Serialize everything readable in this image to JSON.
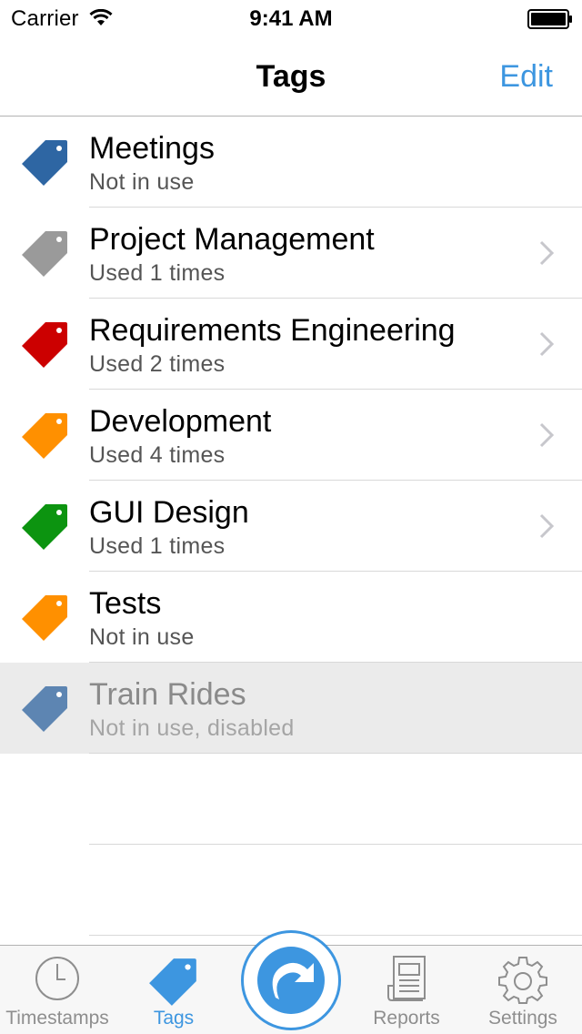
{
  "status_bar": {
    "carrier": "Carrier",
    "time": "9:41 AM"
  },
  "nav": {
    "title": "Tags",
    "edit": "Edit"
  },
  "tags": [
    {
      "name": "Meetings",
      "usage": "Not in use",
      "color": "#2e66a3",
      "chevron": false,
      "disabled": false
    },
    {
      "name": "Project Management",
      "usage": "Used 1 times",
      "color": "#9a9a9a",
      "chevron": true,
      "disabled": false
    },
    {
      "name": "Requirements Engineering",
      "usage": "Used 2 times",
      "color": "#cc0000",
      "chevron": true,
      "disabled": false
    },
    {
      "name": "Development",
      "usage": "Used 4 times",
      "color": "#ff9000",
      "chevron": true,
      "disabled": false
    },
    {
      "name": "GUI Design",
      "usage": "Used 1 times",
      "color": "#0c9410",
      "chevron": true,
      "disabled": false
    },
    {
      "name": "Tests",
      "usage": "Not in use",
      "color": "#ff9000",
      "chevron": false,
      "disabled": false
    },
    {
      "name": "Train Rides",
      "usage": "Not in use, disabled",
      "color": "#5d85b2",
      "chevron": false,
      "disabled": true
    }
  ],
  "tab_bar": {
    "timestamps": "Timestamps",
    "tags": "Tags",
    "reports": "Reports",
    "settings": "Settings",
    "active": "tags"
  },
  "colors": {
    "accent": "#3d96e0",
    "inactive": "#8e8e8e"
  }
}
